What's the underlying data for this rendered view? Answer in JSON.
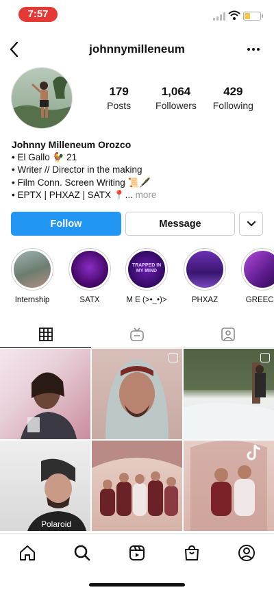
{
  "status_bar": {
    "time": "7:57",
    "battery_level": 0.35
  },
  "nav": {
    "username": "johnnymilleneum"
  },
  "profile": {
    "stats": [
      {
        "value": "179",
        "label": "Posts"
      },
      {
        "value": "1,064",
        "label": "Followers"
      },
      {
        "value": "429",
        "label": "Following"
      }
    ]
  },
  "bio": {
    "name": "Johnny Milleneum Orozco",
    "lines": [
      "• El Gallo 🐓 21",
      "• Writer // Director in the making",
      "• Film Conn. Screen Writing 📜🖋️",
      "• EPTX | PHXAZ | SATX 📍..."
    ],
    "more": "more"
  },
  "buttons": {
    "follow": "Follow",
    "message": "Message"
  },
  "highlights": [
    {
      "label": "Internship"
    },
    {
      "label": "SATX"
    },
    {
      "label": "M E (>•_•)>",
      "cover_text": "TRAPPED IN MY MIND"
    },
    {
      "label": "PHXAZ"
    },
    {
      "label": "GREECE"
    }
  ],
  "tabs": [
    {
      "name": "posts-grid",
      "icon": "grid-icon",
      "active": true
    },
    {
      "name": "reels",
      "icon": "igtv-icon",
      "active": false
    },
    {
      "name": "tagged",
      "icon": "tagged-icon",
      "active": false
    }
  ],
  "bottom_nav": [
    "home-icon",
    "search-icon",
    "reels-icon",
    "shop-icon",
    "profile-icon"
  ]
}
